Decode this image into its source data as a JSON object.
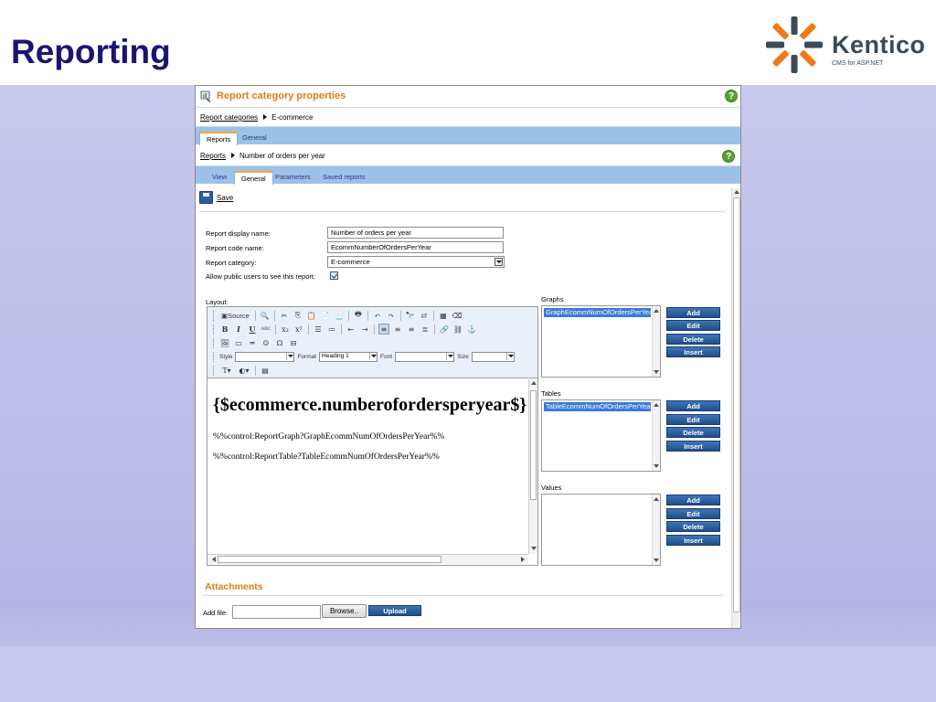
{
  "slide": {
    "title": "Reporting",
    "logo_text": "Kentico",
    "logo_sub": "CMS for ASP.NET"
  },
  "app": {
    "title": "Report category properties",
    "breadcrumb1": {
      "link": "Report categories",
      "current": "E-commerce"
    },
    "tabs1": [
      "Reports",
      "General"
    ],
    "tabs1_active": "Reports",
    "breadcrumb2": {
      "link": "Reports",
      "current": "Number of orders per year"
    },
    "tabs2": [
      "View",
      "General",
      "Parameters",
      "Saved reports"
    ],
    "tabs2_active": "General",
    "save_label": "Save"
  },
  "form": {
    "display_name_label": "Report display name:",
    "display_name_value": "Number of orders per year",
    "code_name_label": "Report code name:",
    "code_name_value": "EcommNumberOfOrdersPerYear",
    "category_label": "Report category:",
    "category_value": "E-commerce",
    "public_label": "Allow public users to see this report:",
    "public_checked": true,
    "layout_label": "Layout:"
  },
  "toolbar": {
    "source_label": "Source",
    "style_label": "Style",
    "format_label": "Format",
    "format_value": "Heading 1",
    "font_label": "Font",
    "size_label": "Size"
  },
  "editor": {
    "heading": "{$ecommerce.numberofordersperyear$}",
    "line1": "%%control:ReportGraph?GraphEcommNumOfOrdersPerYear%%",
    "line2": "%%control:ReportTable?TableEcommNumOfOrdersPerYear%%"
  },
  "graphs": {
    "label": "Graphs",
    "items": [
      "GraphEcommNumOfOrdersPerYear"
    ]
  },
  "tables": {
    "label": "Tables",
    "items": [
      "TableEcommNumOfOrdersPerYear"
    ]
  },
  "values": {
    "label": "Values",
    "items": []
  },
  "buttons": {
    "add": "Add",
    "edit": "Edit",
    "delete": "Delete",
    "insert": "Insert"
  },
  "attachments": {
    "title": "Attachments",
    "add_file_label": "Add file:",
    "browse_label": "Browse..",
    "upload_label": "Upload"
  },
  "colors": {
    "title_orange": "#e07b18",
    "tab_blue": "#9ec1e7",
    "button_blue": "#1e4e8c",
    "slide_title": "#1a1572"
  }
}
